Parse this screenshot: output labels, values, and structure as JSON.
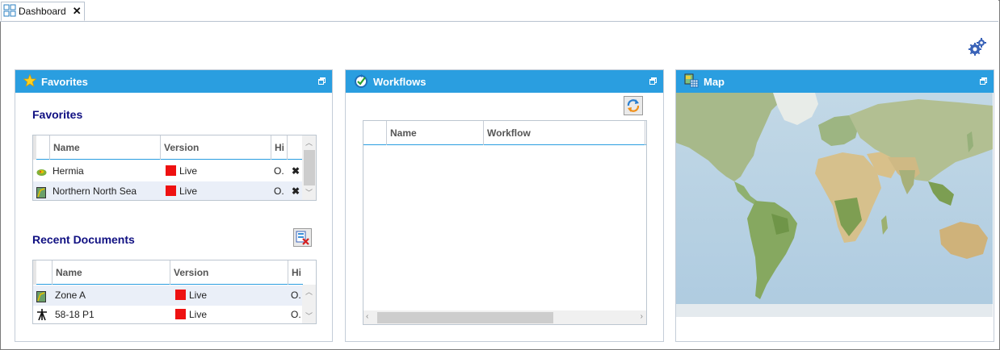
{
  "tab": {
    "label": "Dashboard",
    "close": "✕"
  },
  "favorites_panel": {
    "title": "Favorites",
    "favorites_heading": "Favorites",
    "favorites_grid": {
      "columns": [
        "Name",
        "Version",
        "Hi"
      ],
      "rows": [
        {
          "icon": "horizon-icon",
          "name": "Hermia",
          "version": "Live",
          "hi": "O.",
          "action": "✖"
        },
        {
          "icon": "interpretation-icon",
          "name": "Northern North Sea",
          "version": "Live",
          "hi": "O.",
          "action": "✖"
        }
      ]
    },
    "recent_heading": "Recent Documents",
    "recent_grid": {
      "columns": [
        "Name",
        "Version",
        "Hi"
      ],
      "rows": [
        {
          "icon": "zone-icon",
          "name": "Zone A",
          "version": "Live",
          "hi": "O."
        },
        {
          "icon": "well-icon",
          "name": "58-18 P1",
          "version": "Live",
          "hi": "O."
        }
      ]
    },
    "version_color": "#ee1111"
  },
  "workflows_panel": {
    "title": "Workflows",
    "grid": {
      "columns": [
        "Name",
        "Workflow"
      ],
      "rows": []
    }
  },
  "map_panel": {
    "title": "Map"
  },
  "colors": {
    "header_blue": "#2a9ee0",
    "heading_navy": "#101082",
    "alt_row": "#eaeff8"
  }
}
